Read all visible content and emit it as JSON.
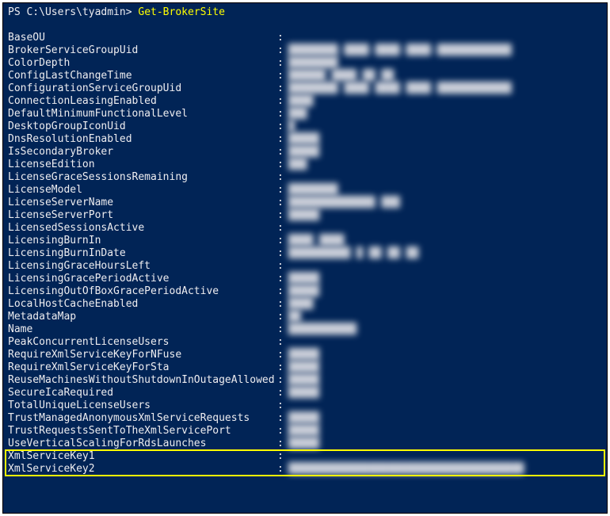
{
  "prompt": "PS C:\\Users\\tyadmin> ",
  "command": "Get-BrokerSite",
  "rows": [
    {
      "key": "BaseOU",
      "value": ""
    },
    {
      "key": "BrokerServiceGroupUid",
      "value": "████████-████-████-████-████████████"
    },
    {
      "key": "ColorDepth",
      "value": "████████"
    },
    {
      "key": "ConfigLastChangeTime",
      "value": "██████ ████ ██ ██"
    },
    {
      "key": "ConfigurationServiceGroupUid",
      "value": "████████ ████ ████ ████ ████████████"
    },
    {
      "key": "ConnectionLeasingEnabled",
      "value": "████"
    },
    {
      "key": "DefaultMinimumFunctionalLevel",
      "value": "███"
    },
    {
      "key": "DesktopGroupIconUid",
      "value": "█"
    },
    {
      "key": "DnsResolutionEnabled",
      "value": "█████"
    },
    {
      "key": "IsSecondaryBroker",
      "value": "█████"
    },
    {
      "key": "LicenseEdition",
      "value": "███"
    },
    {
      "key": "LicenseGraceSessionsRemaining",
      "value": ""
    },
    {
      "key": "LicenseModel",
      "value": "████████"
    },
    {
      "key": "LicenseServerName",
      "value": "██████████████ ███"
    },
    {
      "key": "LicenseServerPort",
      "value": "█████"
    },
    {
      "key": "LicensedSessionsActive",
      "value": ""
    },
    {
      "key": "LicensingBurnIn",
      "value": "████ ████"
    },
    {
      "key": "LicensingBurnInDate",
      "value": "██████████ █ ██ ██ ██"
    },
    {
      "key": "LicensingGraceHoursLeft",
      "value": ""
    },
    {
      "key": "LicensingGracePeriodActive",
      "value": "█████"
    },
    {
      "key": "LicensingOutOfBoxGracePeriodActive",
      "value": "█████"
    },
    {
      "key": "LocalHostCacheEnabled",
      "value": "████"
    },
    {
      "key": "MetadataMap",
      "value": "██"
    },
    {
      "key": "Name",
      "value": "███████████"
    },
    {
      "key": "PeakConcurrentLicenseUsers",
      "value": ""
    },
    {
      "key": "RequireXmlServiceKeyForNFuse",
      "value": "█████"
    },
    {
      "key": "RequireXmlServiceKeyForSta",
      "value": "█████"
    },
    {
      "key": "ReuseMachinesWithoutShutdownInOutageAllowed",
      "value": "█████"
    },
    {
      "key": "SecureIcaRequired",
      "value": "█████"
    },
    {
      "key": "TotalUniqueLicenseUsers",
      "value": ""
    },
    {
      "key": "TrustManagedAnonymousXmlServiceRequests",
      "value": "█████"
    },
    {
      "key": "TrustRequestsSentToTheXmlServicePort",
      "value": "█████"
    },
    {
      "key": "UseVerticalScalingForRdsLaunches",
      "value": "█████"
    },
    {
      "key": "XmlServiceKey1",
      "value": "",
      "highlight": true
    },
    {
      "key": "XmlServiceKey2",
      "value": "██████████████████████████████████████",
      "highlight": true
    }
  ]
}
